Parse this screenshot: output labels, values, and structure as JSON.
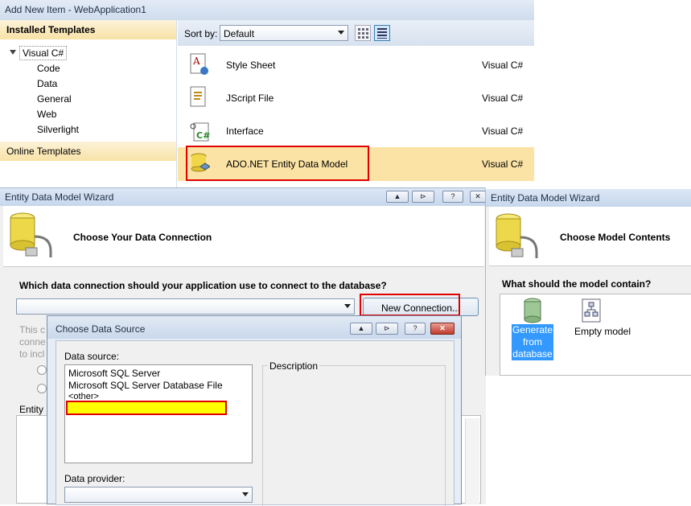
{
  "add_item": {
    "title": "Add New Item - WebApplication1",
    "installed_templates": "Installed Templates",
    "tree_root": "Visual C#",
    "tree_children": [
      "Code",
      "Data",
      "General",
      "Web",
      "Silverlight"
    ],
    "online_templates": "Online Templates",
    "sort_label": "Sort by:",
    "sort_value": "Default",
    "templates": [
      {
        "name": "Style Sheet",
        "lang": "Visual C#",
        "icon": "stylesheet-icon"
      },
      {
        "name": "JScript File",
        "lang": "Visual C#",
        "icon": "jscript-file-icon"
      },
      {
        "name": "Interface",
        "lang": "Visual C#",
        "icon": "interface-icon"
      },
      {
        "name": "ADO.NET Entity Data Model",
        "lang": "Visual C#",
        "icon": "entity-data-model-icon"
      }
    ]
  },
  "wizard1": {
    "title": "Entity Data Model Wizard",
    "heading": "Choose Your Data Connection",
    "question": "Which data connection should your application use to connect to the database?",
    "connection_value": "",
    "new_connection": "New Connection...",
    "partial_text": [
      "This c",
      "conne",
      "to incl"
    ],
    "entity_label": "Entity"
  },
  "wizard2": {
    "title": "Entity Data Model Wizard",
    "heading": "Choose Model Contents",
    "question": "What should the model contain?",
    "options": [
      {
        "label": "Generate from database",
        "icon": "database-icon",
        "selected": true
      },
      {
        "label": "Empty model",
        "icon": "empty-model-icon",
        "selected": false
      }
    ]
  },
  "data_source": {
    "title": "Choose Data Source",
    "data_source_label": "Data source:",
    "sources": [
      "Microsoft SQL Server",
      "Microsoft SQL Server Database File",
      "<other>"
    ],
    "highlight_value": "",
    "description_label": "Description",
    "provider_label": "Data provider:",
    "provider_value": ""
  },
  "colors": {
    "highlight_row": "#fbe3a5",
    "red_box": "#e00000",
    "selected_blue": "#3399ff",
    "yellow_fill": "#ffff00"
  }
}
